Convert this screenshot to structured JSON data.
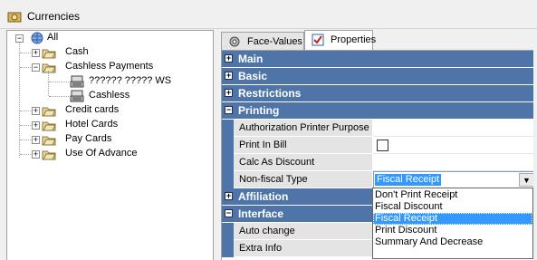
{
  "window": {
    "title": "Currencies"
  },
  "tree": {
    "root": "All",
    "items": [
      {
        "label": "Cash"
      },
      {
        "label": "Cashless Payments"
      },
      {
        "label": "?????? ????? WS"
      },
      {
        "label": "Cashless"
      },
      {
        "label": "Credit cards"
      },
      {
        "label": "Hotel Cards"
      },
      {
        "label": "Pay Cards"
      },
      {
        "label": "Use Of Advance"
      }
    ]
  },
  "tabs": [
    {
      "label": "Face-Values"
    },
    {
      "label": "Properties"
    }
  ],
  "grid": {
    "categories": {
      "main": "Main",
      "basic": "Basic",
      "restrictions": "Restrictions",
      "printing": "Printing",
      "affiliation": "Affiliation",
      "interface": "Interface"
    },
    "printing_props": {
      "auth_printer": "Authorization Printer Purpose",
      "print_in_bill": "Print In Bill",
      "calc_as_discount": "Calc As Discount",
      "non_fiscal_type": "Non-fiscal Type",
      "non_fiscal_value": "Fiscal Receipt"
    },
    "interface_props": {
      "auto_change": "Auto change",
      "extra_info": "Extra Info"
    },
    "expand_symbol": "+",
    "collapse_symbol": "−"
  },
  "dropdown": {
    "options": [
      "Don't Print Receipt",
      "Fiscal Discount",
      "Fiscal Receipt",
      "Print Discount",
      "Summary And Decrease"
    ],
    "selected": "Fiscal Receipt"
  },
  "colors": {
    "category_bg": "#4f74a8",
    "selection": "#3399ff"
  }
}
